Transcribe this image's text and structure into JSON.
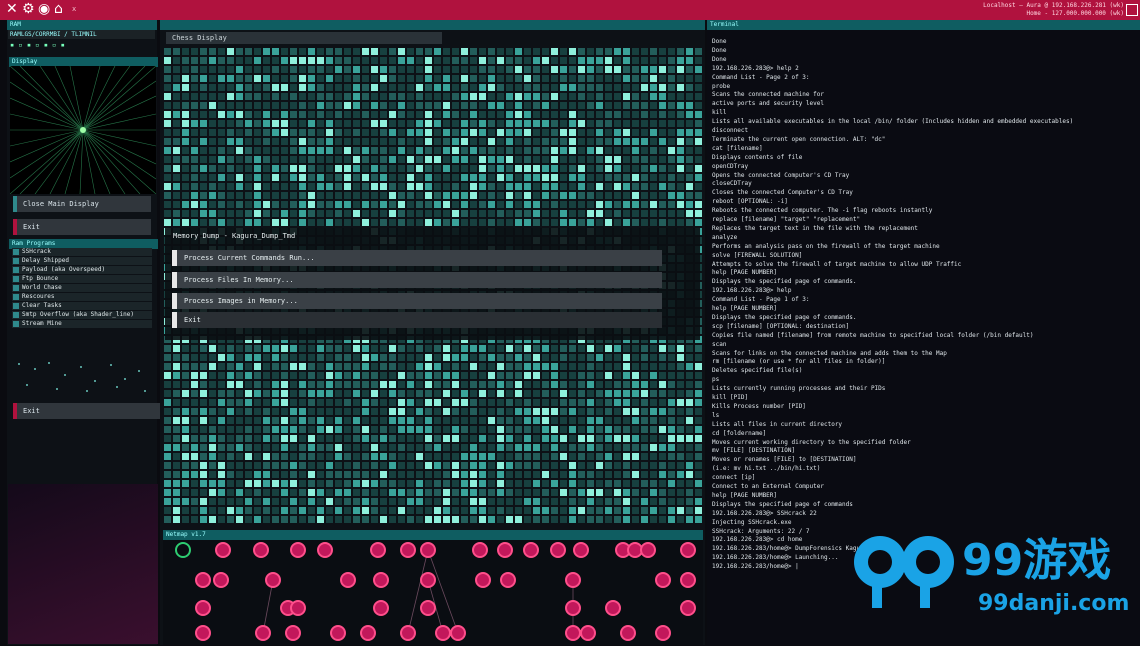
{
  "topbar": {
    "title": "x",
    "right_line1": "Localhost — Aura @ 192.168.226.281 (wk)",
    "right_line2": "Home - 127.000.000.000 (wk)"
  },
  "left_panel": {
    "header": "RAM",
    "path": "RAMLGS/CORRMBI / TLIMNIL",
    "display_header": "Display",
    "close_button": "Close Main Display",
    "exit_button": "Exit",
    "programs_header": "Ram Programs",
    "programs": [
      "SSHcrack",
      "Delay Shipped",
      "Payload (aka Overspeed)",
      "Ftp Bounce",
      "World Chase",
      "Rescoures",
      "Clear Tasks",
      "Smtp Overflow (aka Shader_line)",
      "Stream Mine"
    ],
    "exit_button_2": "Exit"
  },
  "center_panel": {
    "tab": "Chess Display",
    "dialog_title": "Memory Dump - Kagura_Dump_Tmd",
    "buttons": [
      "Process Current Commands Run...",
      "Process Files In Memory...",
      "Process Images in Memory..."
    ],
    "exit_button": "Exit"
  },
  "terminal": {
    "header": "Terminal",
    "lines": [
      "Done",
      "Done",
      "Done",
      "192.168.226.283@> help 2",
      "Command List - Page 2 of 3:",
      "probe",
      "   Scans the connected machine for",
      "   active ports and security level",
      "kill",
      "   Lists all available executables in the local /bin/ folder (Includes hidden and embedded executables)",
      "disconnect",
      "   Terminate the current open connection. ALT: \"dc\"",
      "cat [filename]",
      "   Displays contents of file",
      "openCDTray",
      "   Opens the connected Computer's CD Tray",
      "closeCDTray",
      "   Closes the connected Computer's CD Tray",
      "reboot [OPTIONAL: -i]",
      "   Reboots the connected computer. The -i flag reboots instantly",
      "replace [filename] \"target\" \"replacement\"",
      "   Replaces the target text in the file with the replacement",
      "analyze",
      "   Performs an analysis pass on the firewall of the target machine",
      "solve [FIREWALL SOLUTION]",
      "   Attempts to solve the firewall of target machine to allow UDP Traffic",
      "help [PAGE NUMBER]",
      "   Displays the specified page of commands.",
      "192.168.226.283@> help",
      "Command List - Page 1 of 3:",
      "help [PAGE NUMBER]",
      "   Displays the specified page of commands.",
      "scp [filename] [OPTIONAL: destination]",
      "   Copies file named [filename] from remote machine to specified local folder (/bin default)",
      "scan",
      "   Scans for links on the connected machine and adds them to the Map",
      "rm [filename (or use * for all files in folder)]",
      "   Deletes specified file(s)",
      "ps",
      "   Lists currently running processes and their PIDs",
      "kill [PID]",
      "   Kills Process number [PID]",
      "ls",
      "   Lists all files in current directory",
      "cd [foldername]",
      "   Moves current working directory to the specified folder",
      "mv [FILE] [DESTINATION]",
      "   Moves or renames [FILE] to [DESTINATION]",
      "   (i.e: mv hi.txt ../bin/hi.txt)",
      "connect [ip]",
      "   Connect to an External Computer",
      "help [PAGE NUMBER]",
      "   Displays the specified page of commands",
      "192.168.226.283@> SSHcrack 22",
      "Injecting SSHcrack.exe",
      "SSHcrack: Arguments: 22 / 7",
      "192.168.226.283@> cd home",
      "192.168.226.283/home@> DumpForensics Kagura_Dump_Tmd",
      "192.168.226.283/home@> Launching...",
      "192.168.226.283/home@> |"
    ]
  },
  "netmap": {
    "header": "Netmap v1.7"
  },
  "watermark": {
    "logo_text": "99游戏",
    "url": "99danji.com"
  },
  "colors": {
    "accent": "#b0123e",
    "teal": "#0f5d61",
    "node": "#c2185b",
    "home_node": "#2ecc71"
  }
}
